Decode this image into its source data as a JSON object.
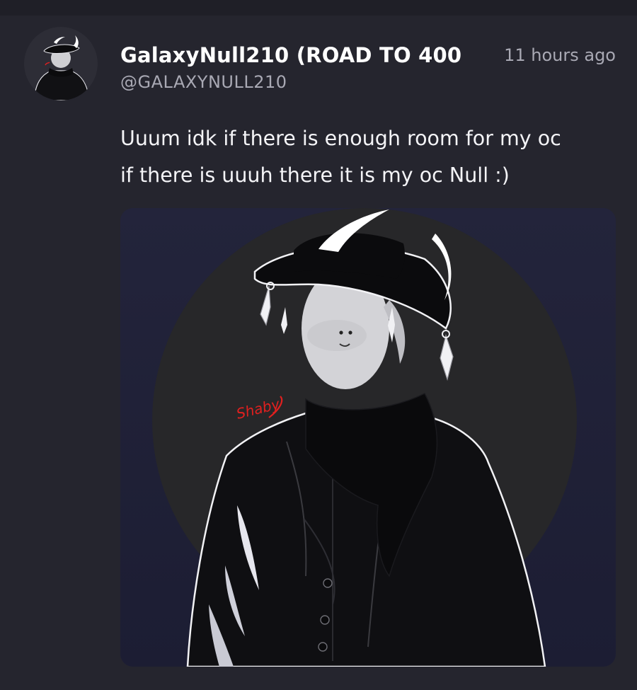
{
  "post": {
    "author": {
      "display_name": "GalaxyNull210 (ROAD TO 400",
      "handle": "@GALAXYNULL210"
    },
    "timestamp": "11 hours ago",
    "text_lines": [
      "Uuum idk if there is enough room for my oc",
      "if there is uuuh there it is my oc Null :)"
    ],
    "image": {
      "signature": "Shaby"
    }
  },
  "colors": {
    "background": "#25252e",
    "image_background": "#22233a",
    "name_text": "#ffffff",
    "meta_text": "#a9a9b4",
    "signature_red": "#e0201f"
  }
}
